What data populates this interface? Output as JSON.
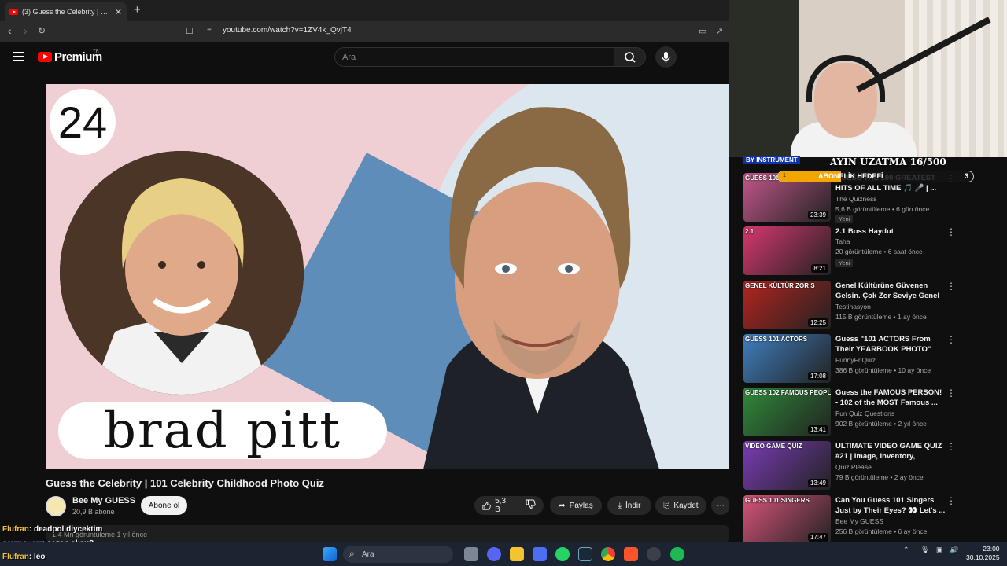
{
  "browser": {
    "tab_title": "(3) Guess the Celebrity | 101 C",
    "url": "youtube.com/watch?v=1ZV4k_QvjT4",
    "new_tab": "+",
    "close": "✕"
  },
  "youtube": {
    "logo": "Premium",
    "logo_sup": "TR",
    "search_placeholder": "Ara"
  },
  "video": {
    "number": "24",
    "name": "brad pitt",
    "title": "Guess the Celebrity | 101 Celebrity Childhood Photo Quiz",
    "channel": "Bee My GUESS",
    "subscribers": "20,9 B abone",
    "subscribe_label": "Abone ol",
    "likes": "5,3 B",
    "share_label": "Paylaş",
    "download_label": "İndir",
    "save_label": "Kaydet",
    "meta": "1,4 Mn görüntüleme  1 yıl önce"
  },
  "overlay": {
    "sub_goal": "AYIN UZATMA 16/500",
    "instrument": "BY INSTRUMENT",
    "goal_label": "ABONELİK HEDEFİ",
    "goal_left": "1",
    "goal_right": "3"
  },
  "recommendations": [
    {
      "thumb": "GUESS 100 GREATEST",
      "title": "GUESS THE 100 GREATEST HITS OF ALL TIME 🎵 🎤 | ...",
      "channel": "The Quizness",
      "meta": "5,6 B görüntüleme • 6 gün önce",
      "badge": "Yeni",
      "duration": "23:39",
      "color": "#c2578a"
    },
    {
      "thumb": "2.1",
      "title": "2.1 Boss Haydut",
      "channel": "Taha",
      "meta": "20 görüntüleme • 6 saat önce",
      "badge": "Yeni",
      "duration": "8:21",
      "color": "#d6376f"
    },
    {
      "thumb": "GENEL KÜLTÜR ZOR S",
      "title": "Genel Kültürüne Güvenen Gelsin. Çok Zor Seviye Genel ...",
      "channel": "Testinasyon",
      "meta": "115 B görüntüleme • 1 ay önce",
      "badge": "",
      "duration": "12:25",
      "color": "#b3241f"
    },
    {
      "thumb": "GUESS 101 ACTORS",
      "title": "Guess \"101 ACTORS From Their YEARBOOK PHOTO\" QUIZ! 👀 ...",
      "channel": "FunnyFriQuiz",
      "meta": "386 B görüntüleme • 10 ay önce",
      "badge": "",
      "duration": "17:08",
      "color": "#3f7fbf"
    },
    {
      "thumb": "GUESS 102 FAMOUS PEOPLE",
      "title": "Guess the FAMOUS PERSON! - 102 of the MOST Famous ...",
      "channel": "Fun Quiz Questions",
      "meta": "902 B görüntüleme • 2 yıl önce",
      "badge": "",
      "duration": "13:41",
      "color": "#2f8a3a"
    },
    {
      "thumb": "VIDEO GAME QUIZ",
      "title": "ULTIMATE VIDEO GAME QUIZ #21 | Image, Inventory, Loadin...",
      "channel": "Quiz Please",
      "meta": "79 B görüntüleme • 2 ay önce",
      "badge": "",
      "duration": "13:49",
      "color": "#7a3cb5"
    },
    {
      "thumb": "GUESS 101 SINGERS",
      "title": "Can You Guess 101 Singers Just by Their Eyes? 👀 Let's ...",
      "channel": "Bee My GUESS",
      "meta": "256 B görüntüleme • 6 ay önce",
      "badge": "",
      "duration": "17:47",
      "color": "#d7547a"
    }
  ],
  "chat": [
    {
      "user": "Flufran",
      "message": ": deadpol diycektim"
    },
    {
      "user": "seymoverr",
      "message": ": sezen aksu?"
    },
    {
      "user": "Flufran",
      "message": ": leo"
    }
  ],
  "taskbar": {
    "search_label": "Ara",
    "time": "23:00",
    "date": "30.10.2025"
  }
}
